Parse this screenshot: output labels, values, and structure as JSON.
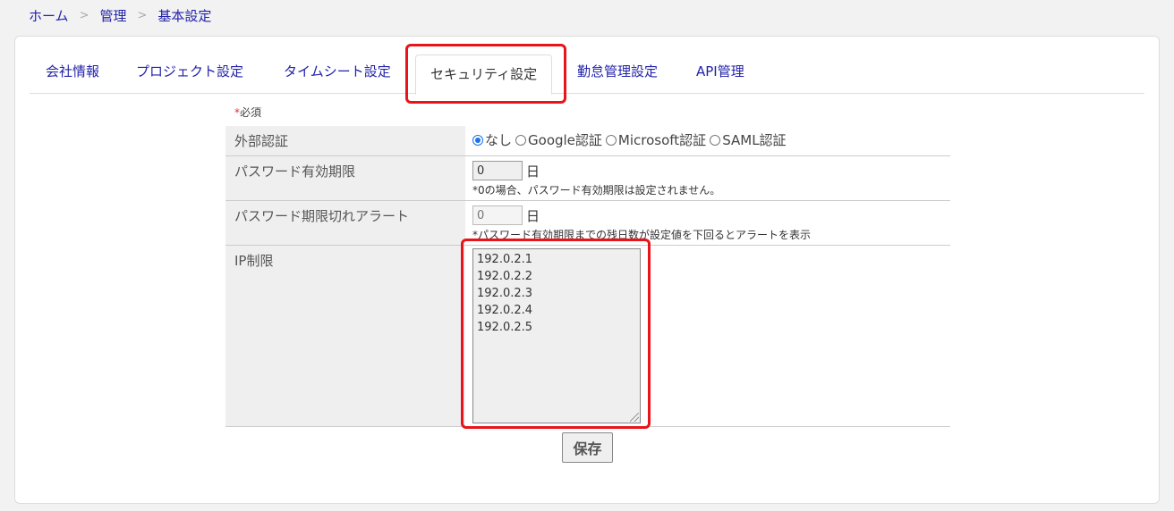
{
  "breadcrumb": {
    "items": [
      "ホーム",
      "管理",
      "基本設定"
    ],
    "separator": ">"
  },
  "tabs": [
    {
      "label": "会社情報",
      "active": false
    },
    {
      "label": "プロジェクト設定",
      "active": false
    },
    {
      "label": "タイムシート設定",
      "active": false
    },
    {
      "label": "セキュリティ設定",
      "active": true
    },
    {
      "label": "勤怠管理設定",
      "active": false
    },
    {
      "label": "API管理",
      "active": false
    }
  ],
  "form": {
    "required_mark": "*",
    "required_label": "必須",
    "external_auth": {
      "label": "外部認証",
      "options": [
        "なし",
        "Google認証",
        "Microsoft認証",
        "SAML認証"
      ],
      "selected": "なし"
    },
    "password_expiry": {
      "label": "パスワード有効期限",
      "value": "0",
      "unit": "日",
      "note": "*0の場合、パスワード有効期限は設定されません。"
    },
    "password_alert": {
      "label": "パスワード期限切れアラート",
      "placeholder": "0",
      "unit": "日",
      "note": "*パスワード有効期限までの残日数が設定値を下回るとアラートを表示"
    },
    "ip_restriction": {
      "label": "IP制限",
      "value": "192.0.2.1\n192.0.2.2\n192.0.2.3\n192.0.2.4\n192.0.2.5"
    },
    "save_label": "保存"
  },
  "colors": {
    "link": "#2222aa",
    "highlight": "#e8141a",
    "label_bg": "#efefef"
  }
}
